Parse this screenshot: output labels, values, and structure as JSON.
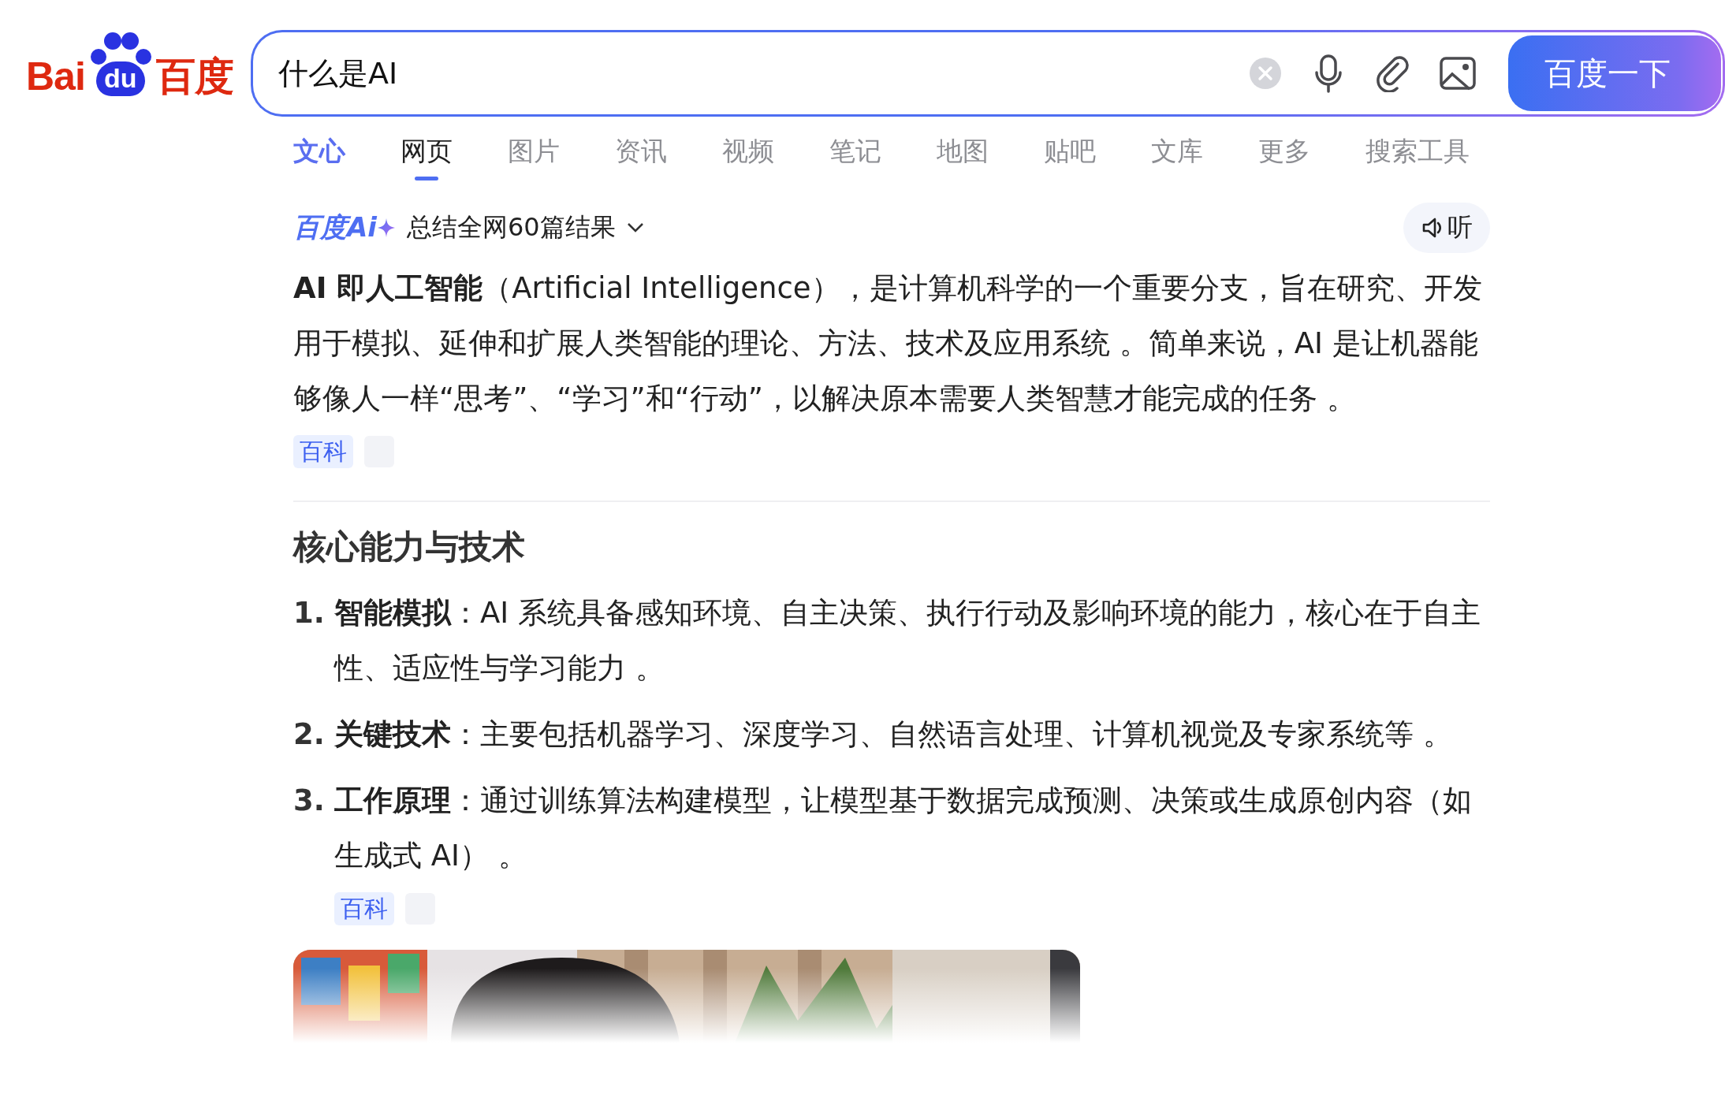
{
  "logo": {
    "left": "Bai",
    "paw": "du",
    "right": "百度"
  },
  "search": {
    "value": "什么是AI",
    "button": "百度一下"
  },
  "tabs": [
    {
      "label": "文心",
      "kind": "brand",
      "selected": false
    },
    {
      "label": "网页",
      "kind": "plain",
      "selected": true
    },
    {
      "label": "图片",
      "kind": "plain",
      "selected": false
    },
    {
      "label": "资讯",
      "kind": "plain",
      "selected": false
    },
    {
      "label": "视频",
      "kind": "plain",
      "selected": false
    },
    {
      "label": "笔记",
      "kind": "plain",
      "selected": false
    },
    {
      "label": "地图",
      "kind": "plain",
      "selected": false
    },
    {
      "label": "贴吧",
      "kind": "plain",
      "selected": false
    },
    {
      "label": "文库",
      "kind": "plain",
      "selected": false
    },
    {
      "label": "更多",
      "kind": "plain",
      "selected": false
    },
    {
      "label": "搜索工具",
      "kind": "plain",
      "selected": false
    }
  ],
  "ai_summary": {
    "badge": "百度Ai",
    "caption": "总结全网60篇结果",
    "listen": "听",
    "paragraph": {
      "text": "**AI 即人工智能**（Artificial Intelligence），是计算机科学的一个重要分支，旨在研究、开发用于模拟、延伸和扩展人类智能的理论、方法、技术及应用系统 。简单来说，AI 是让机器能够像人一样“思考”、“学习”和“行动”，以解决原本需要人类智慧才能完成的任务 。",
      "source": "百科"
    },
    "section": {
      "heading": "核心能力与技术",
      "items": [
        {
          "number": "1.",
          "text": "**智能模拟**：AI 系统具备感知环境、自主决策、执行行动及影响环境的能力，核心在于自主性、适应性与学习能力 。"
        },
        {
          "number": "2.",
          "text": "**关键技术**：主要包括机器学习、深度学习、自然语言处理、计算机视觉及专家系统等 。"
        },
        {
          "number": "3.",
          "text": "**工作原理**：通过训练算法构建模型，让模型基于数据完成预测、决策或生成原创内容（如生成式 AI） 。",
          "source": "百科"
        }
      ]
    }
  }
}
